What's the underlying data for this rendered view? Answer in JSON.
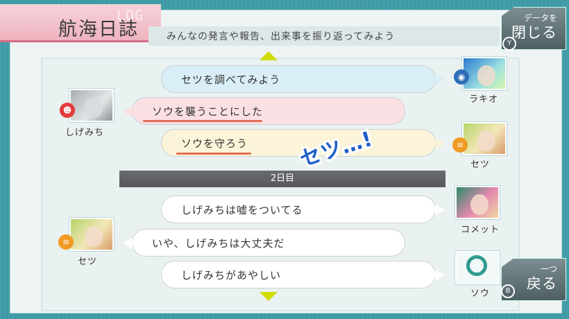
{
  "header": {
    "title": "航海日誌",
    "watermark": "LOG",
    "subtitle": "みんなの発言や報告、出来事を振り返ってみよう"
  },
  "buttons": {
    "data_close": {
      "top_label": "データを",
      "main_label": "閉じる",
      "key": "Y"
    },
    "back": {
      "top_label": "一つ",
      "main_label": "戻る",
      "key": "B"
    }
  },
  "entries": [
    {
      "speaker": "ラキオ",
      "text": "セツを調べてみよう",
      "side": "right",
      "style": "blue"
    },
    {
      "speaker": "しげみち",
      "text": "ソウを襲うことにした",
      "side": "left",
      "style": "pink"
    },
    {
      "speaker": "セツ",
      "text": "ソウを守ろう",
      "side": "right",
      "style": "yellow"
    },
    {
      "speaker": "コメット",
      "text": "しげみちは嘘をついてる",
      "side": "right",
      "style": "white"
    },
    {
      "speaker": "セツ",
      "text": "いや、しげみちは大丈夫だ",
      "side": "left",
      "style": "white"
    },
    {
      "speaker": "ソウ",
      "text": "しげみちがあやしい",
      "side": "right",
      "style": "white"
    }
  ],
  "day_divider": "2日目",
  "shout": "セツ…!",
  "colors": {
    "background": "#3d9aa6",
    "scroll_arrow": "#cfdc00",
    "underline": "#e26b55",
    "title_tab": "#eeb3bf"
  }
}
